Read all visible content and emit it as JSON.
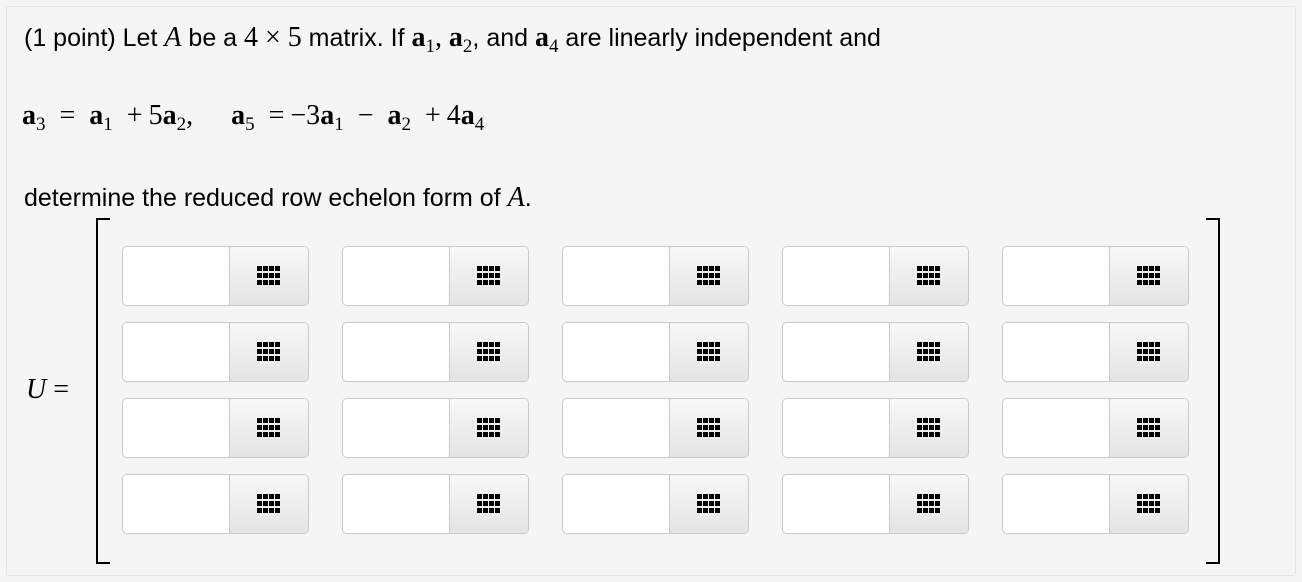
{
  "problem": {
    "intro": "(1 point) Let ",
    "matrix_name": "A",
    "be_a": " be a ",
    "rows": "4",
    "times": "×",
    "cols": "5",
    "matrix_word": " matrix. If ",
    "vec": "a",
    "i1": "1",
    "comma": ",",
    "i2": "2",
    "and_word": ", and ",
    "i4": "4",
    "tail": " are linearly independent and",
    "i3": "3",
    "i5": "5",
    "eq": "=",
    "plus": "+",
    "minus": "−",
    "coef5": "5",
    "neg3": "−3",
    "coef4": "4",
    "determine": "determine the reduced row echelon form of ",
    "period": "."
  },
  "answer": {
    "label": "U",
    "eq": "=",
    "grid_icon": "grid-menu-icon",
    "cells": [
      [
        "",
        "",
        "",
        "",
        ""
      ],
      [
        "",
        "",
        "",
        "",
        ""
      ],
      [
        "",
        "",
        "",
        "",
        ""
      ],
      [
        "",
        "",
        "",
        "",
        ""
      ]
    ]
  }
}
